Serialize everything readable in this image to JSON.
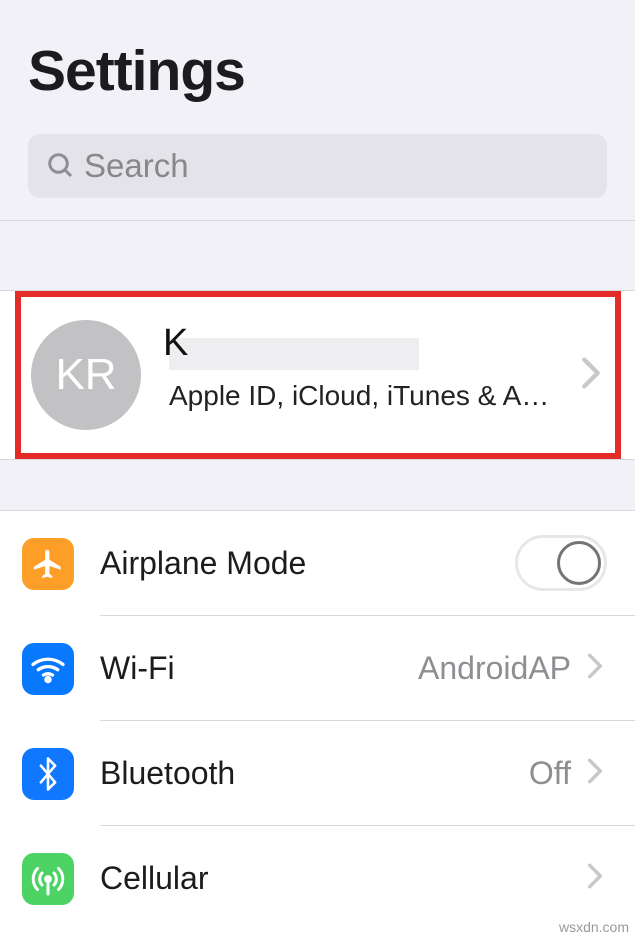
{
  "header": {
    "title": "Settings",
    "search_placeholder": "Search"
  },
  "account": {
    "avatar_initials": "KR",
    "name_partial": "K",
    "subtitle": "Apple ID, iCloud, iTunes & App…"
  },
  "rows": {
    "airplane": {
      "label": "Airplane Mode",
      "toggle": false
    },
    "wifi": {
      "label": "Wi-Fi",
      "detail": "AndroidAP"
    },
    "bluetooth": {
      "label": "Bluetooth",
      "detail": "Off"
    },
    "cellular": {
      "label": "Cellular"
    }
  },
  "watermark": "wsxdn.com"
}
